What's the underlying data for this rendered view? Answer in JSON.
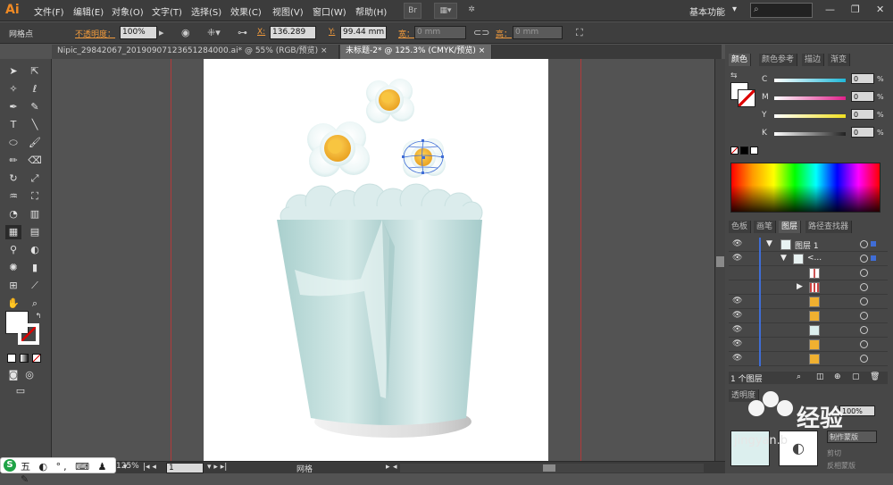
{
  "app": {
    "logo": "Ai",
    "menu": [
      "文件(F)",
      "编辑(E)",
      "对象(O)",
      "文字(T)",
      "选择(S)",
      "效果(C)",
      "视图(V)",
      "窗口(W)",
      "帮助(H)"
    ],
    "bridge_label": "Br",
    "workspace": "基本功能",
    "window_controls": [
      "—",
      "❐",
      "✕"
    ]
  },
  "control_bar": {
    "tool_name": "网格点",
    "opacity_label": "不透明度：",
    "opacity_value": "100%",
    "x_label": "X:",
    "x_value": "136.289",
    "y_label": "Y:",
    "y_value": "99.44 mm",
    "w_label": "宽：",
    "w_value": "0 mm",
    "h_label": "高：",
    "h_value": "0 mm"
  },
  "tabs": [
    {
      "label": "Nipic_29842067_20190907123651284000.ai* @ 55% (RGB/预览)",
      "active": false
    },
    {
      "label": "未标题-2* @ 125.3% (CMYK/预览)",
      "active": true
    }
  ],
  "status": {
    "zoom": "125%",
    "page": "1",
    "mode": "网格"
  },
  "ime": {
    "badge": "S",
    "text": "五 ◐ °, ⌨ ♟ ✎"
  },
  "color_panel": {
    "tabs": [
      "颜色",
      "颜色参考",
      "描边",
      "渐变"
    ],
    "channels": [
      {
        "label": "C",
        "value": "0",
        "color": "#20b8d8"
      },
      {
        "label": "M",
        "value": "0",
        "color": "#e0208a"
      },
      {
        "label": "Y",
        "value": "0",
        "color": "#f0e020"
      },
      {
        "label": "K",
        "value": "0",
        "color": "#222222"
      }
    ],
    "percent": "%"
  },
  "layers_panel": {
    "tabs": [
      "色板",
      "画笔",
      "图层",
      "路径查找器"
    ],
    "layer_name": "图层 1",
    "group_name": "<...",
    "footer_count": "1 个图层"
  },
  "bottom_panel": {
    "tab": "透明度",
    "opacity_value": "100%",
    "make_mask": "制作蒙版",
    "clip": "剪切",
    "invert": "反相蒙版"
  },
  "watermark": {
    "text": "经验",
    "sub": "jingyan.b"
  },
  "colors": {
    "accent_orange": "#f08a24",
    "cup": "#bcd9d8",
    "egg_yolk": "#f0b030",
    "layer_blue": "#3f6dd6"
  }
}
